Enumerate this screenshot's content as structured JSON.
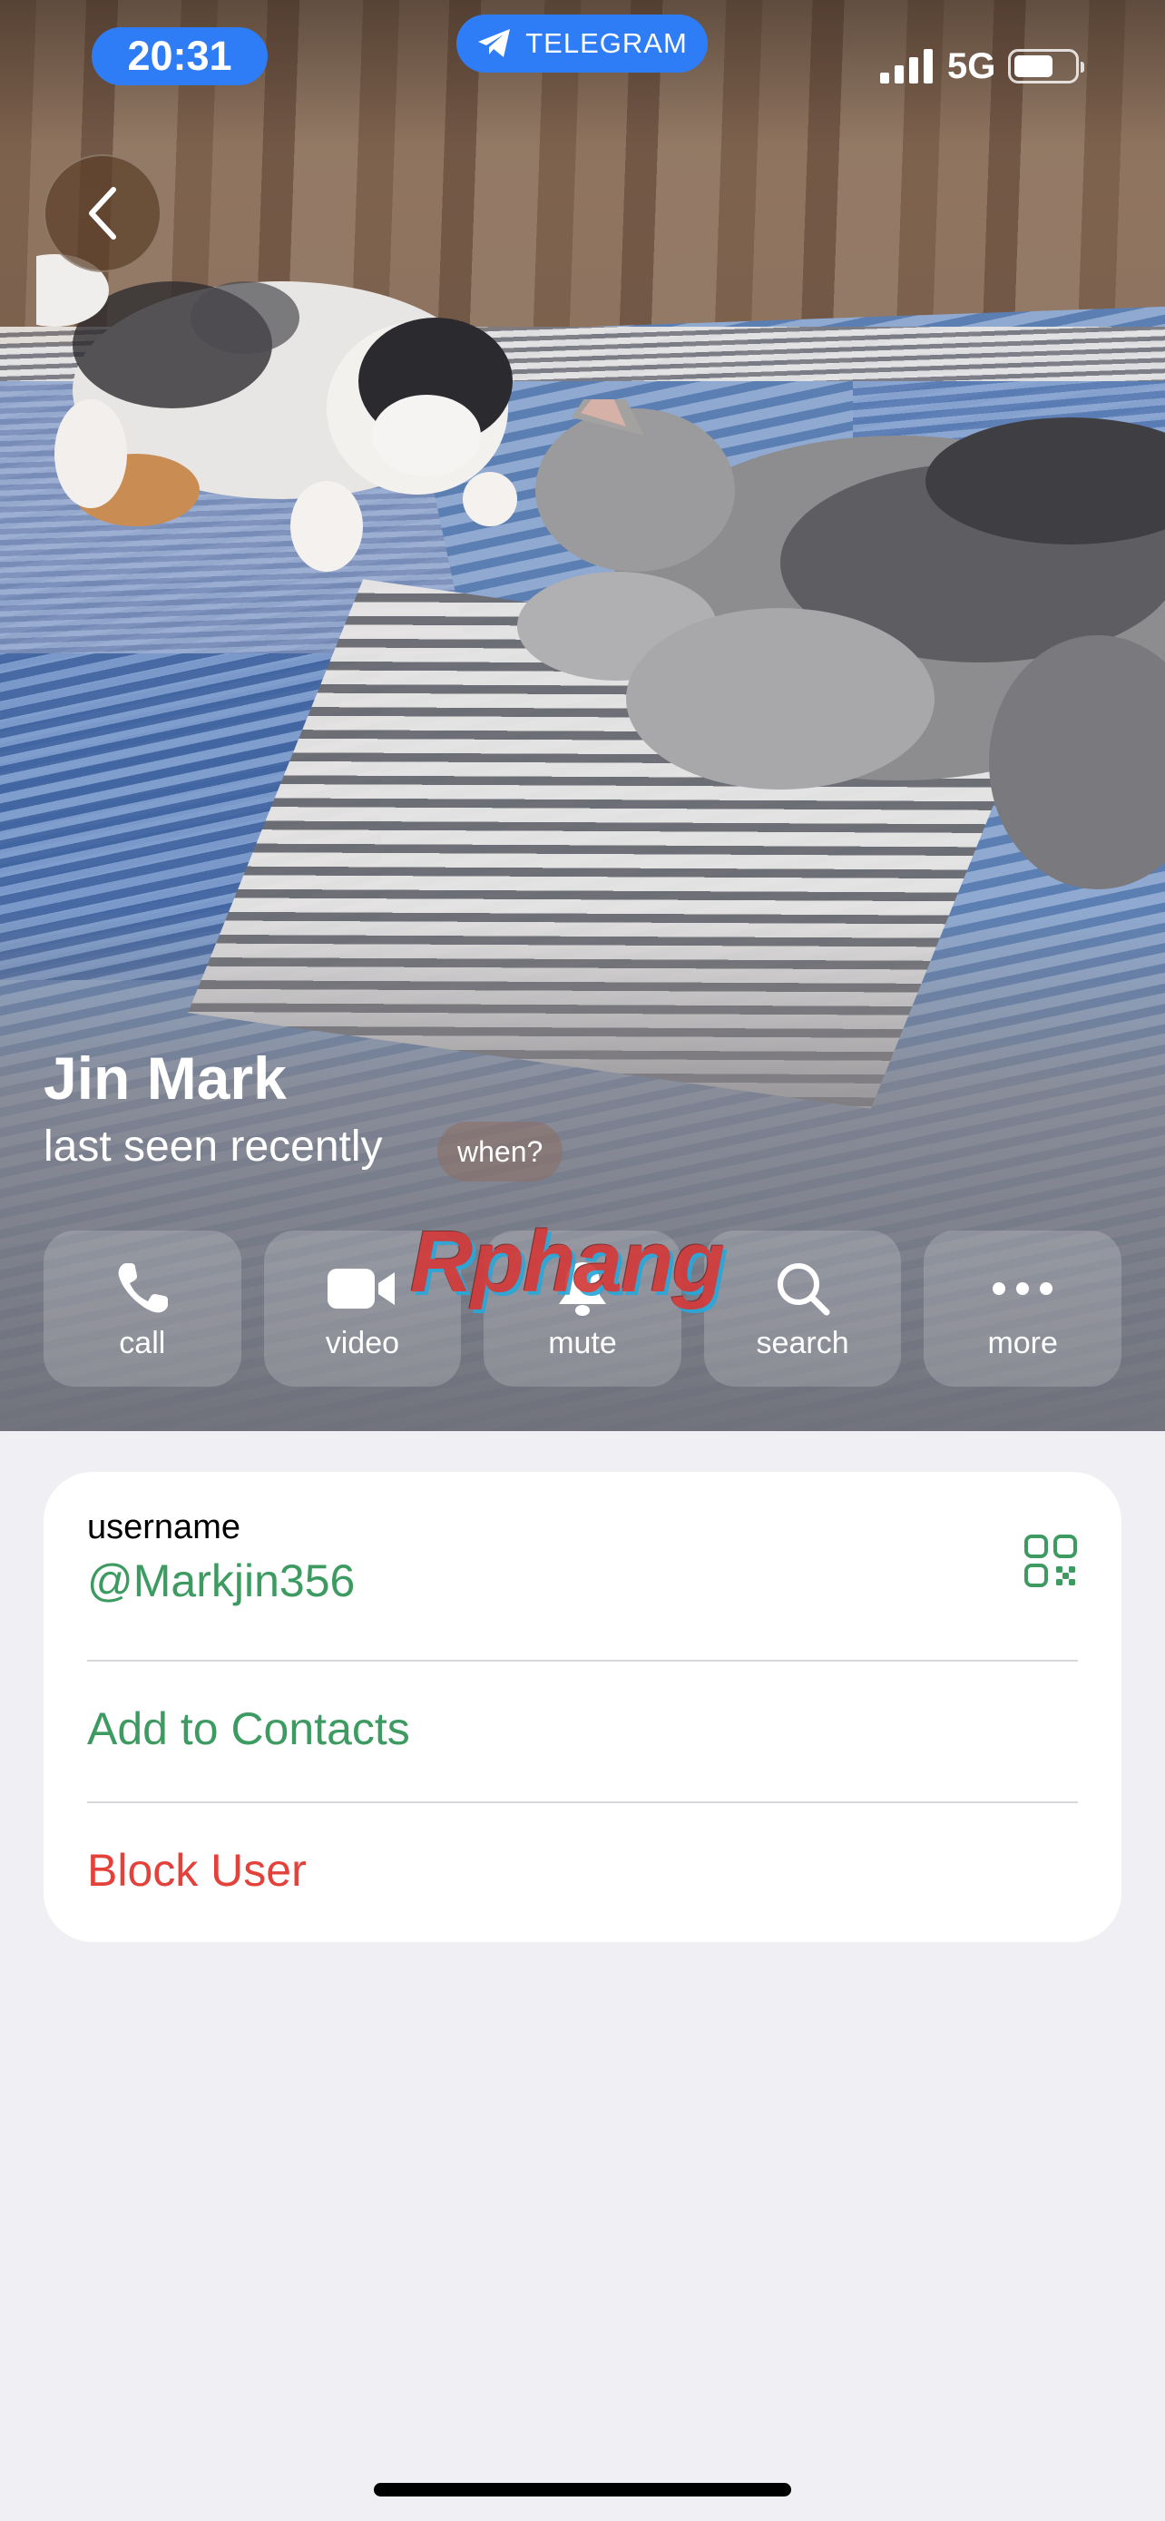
{
  "status_bar": {
    "time": "20:31",
    "app_pill": "TELEGRAM",
    "network": "5G"
  },
  "profile": {
    "name": "Jin Mark",
    "status": "last seen recently",
    "when_label": "when?"
  },
  "actions": [
    {
      "label": "call",
      "icon": "phone-icon"
    },
    {
      "label": "video",
      "icon": "video-camera-icon"
    },
    {
      "label": "mute",
      "icon": "bell-icon"
    },
    {
      "label": "search",
      "icon": "search-icon"
    },
    {
      "label": "more",
      "icon": "more-dots-icon"
    }
  ],
  "watermark": "Rphang",
  "info": {
    "username_label": "username",
    "username_value": "@Markjin356",
    "add_contact": "Add to Contacts",
    "block": "Block User"
  },
  "colors": {
    "accent_green": "#3d9b62",
    "danger_red": "#e5413b",
    "pill_blue": "#2f7df6",
    "background": "#efeff4"
  }
}
